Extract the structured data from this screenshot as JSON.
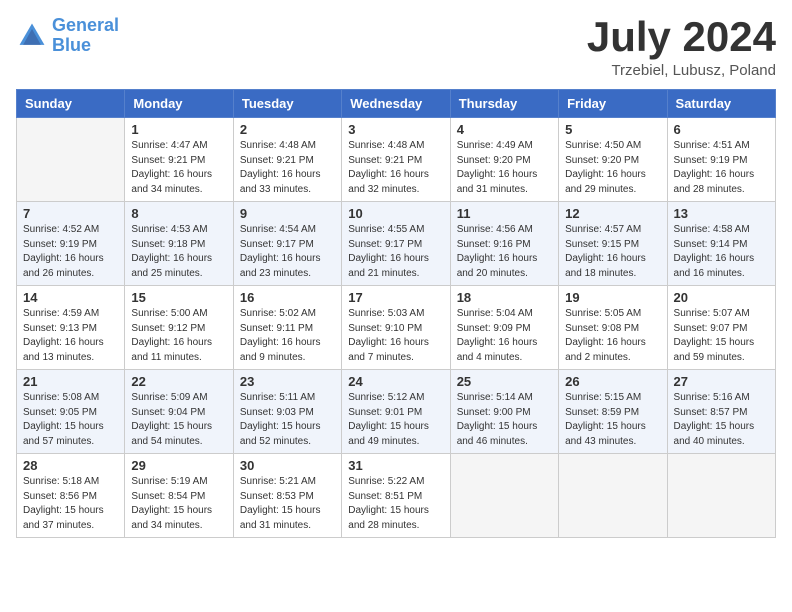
{
  "header": {
    "logo_line1": "General",
    "logo_line2": "Blue",
    "month_title": "July 2024",
    "subtitle": "Trzebiel, Lubusz, Poland"
  },
  "days_of_week": [
    "Sunday",
    "Monday",
    "Tuesday",
    "Wednesday",
    "Thursday",
    "Friday",
    "Saturday"
  ],
  "weeks": [
    [
      {
        "day": "",
        "sunrise": "",
        "sunset": "",
        "daylight": ""
      },
      {
        "day": "1",
        "sunrise": "Sunrise: 4:47 AM",
        "sunset": "Sunset: 9:21 PM",
        "daylight": "Daylight: 16 hours and 34 minutes."
      },
      {
        "day": "2",
        "sunrise": "Sunrise: 4:48 AM",
        "sunset": "Sunset: 9:21 PM",
        "daylight": "Daylight: 16 hours and 33 minutes."
      },
      {
        "day": "3",
        "sunrise": "Sunrise: 4:48 AM",
        "sunset": "Sunset: 9:21 PM",
        "daylight": "Daylight: 16 hours and 32 minutes."
      },
      {
        "day": "4",
        "sunrise": "Sunrise: 4:49 AM",
        "sunset": "Sunset: 9:20 PM",
        "daylight": "Daylight: 16 hours and 31 minutes."
      },
      {
        "day": "5",
        "sunrise": "Sunrise: 4:50 AM",
        "sunset": "Sunset: 9:20 PM",
        "daylight": "Daylight: 16 hours and 29 minutes."
      },
      {
        "day": "6",
        "sunrise": "Sunrise: 4:51 AM",
        "sunset": "Sunset: 9:19 PM",
        "daylight": "Daylight: 16 hours and 28 minutes."
      }
    ],
    [
      {
        "day": "7",
        "sunrise": "Sunrise: 4:52 AM",
        "sunset": "Sunset: 9:19 PM",
        "daylight": "Daylight: 16 hours and 26 minutes."
      },
      {
        "day": "8",
        "sunrise": "Sunrise: 4:53 AM",
        "sunset": "Sunset: 9:18 PM",
        "daylight": "Daylight: 16 hours and 25 minutes."
      },
      {
        "day": "9",
        "sunrise": "Sunrise: 4:54 AM",
        "sunset": "Sunset: 9:17 PM",
        "daylight": "Daylight: 16 hours and 23 minutes."
      },
      {
        "day": "10",
        "sunrise": "Sunrise: 4:55 AM",
        "sunset": "Sunset: 9:17 PM",
        "daylight": "Daylight: 16 hours and 21 minutes."
      },
      {
        "day": "11",
        "sunrise": "Sunrise: 4:56 AM",
        "sunset": "Sunset: 9:16 PM",
        "daylight": "Daylight: 16 hours and 20 minutes."
      },
      {
        "day": "12",
        "sunrise": "Sunrise: 4:57 AM",
        "sunset": "Sunset: 9:15 PM",
        "daylight": "Daylight: 16 hours and 18 minutes."
      },
      {
        "day": "13",
        "sunrise": "Sunrise: 4:58 AM",
        "sunset": "Sunset: 9:14 PM",
        "daylight": "Daylight: 16 hours and 16 minutes."
      }
    ],
    [
      {
        "day": "14",
        "sunrise": "Sunrise: 4:59 AM",
        "sunset": "Sunset: 9:13 PM",
        "daylight": "Daylight: 16 hours and 13 minutes."
      },
      {
        "day": "15",
        "sunrise": "Sunrise: 5:00 AM",
        "sunset": "Sunset: 9:12 PM",
        "daylight": "Daylight: 16 hours and 11 minutes."
      },
      {
        "day": "16",
        "sunrise": "Sunrise: 5:02 AM",
        "sunset": "Sunset: 9:11 PM",
        "daylight": "Daylight: 16 hours and 9 minutes."
      },
      {
        "day": "17",
        "sunrise": "Sunrise: 5:03 AM",
        "sunset": "Sunset: 9:10 PM",
        "daylight": "Daylight: 16 hours and 7 minutes."
      },
      {
        "day": "18",
        "sunrise": "Sunrise: 5:04 AM",
        "sunset": "Sunset: 9:09 PM",
        "daylight": "Daylight: 16 hours and 4 minutes."
      },
      {
        "day": "19",
        "sunrise": "Sunrise: 5:05 AM",
        "sunset": "Sunset: 9:08 PM",
        "daylight": "Daylight: 16 hours and 2 minutes."
      },
      {
        "day": "20",
        "sunrise": "Sunrise: 5:07 AM",
        "sunset": "Sunset: 9:07 PM",
        "daylight": "Daylight: 15 hours and 59 minutes."
      }
    ],
    [
      {
        "day": "21",
        "sunrise": "Sunrise: 5:08 AM",
        "sunset": "Sunset: 9:05 PM",
        "daylight": "Daylight: 15 hours and 57 minutes."
      },
      {
        "day": "22",
        "sunrise": "Sunrise: 5:09 AM",
        "sunset": "Sunset: 9:04 PM",
        "daylight": "Daylight: 15 hours and 54 minutes."
      },
      {
        "day": "23",
        "sunrise": "Sunrise: 5:11 AM",
        "sunset": "Sunset: 9:03 PM",
        "daylight": "Daylight: 15 hours and 52 minutes."
      },
      {
        "day": "24",
        "sunrise": "Sunrise: 5:12 AM",
        "sunset": "Sunset: 9:01 PM",
        "daylight": "Daylight: 15 hours and 49 minutes."
      },
      {
        "day": "25",
        "sunrise": "Sunrise: 5:14 AM",
        "sunset": "Sunset: 9:00 PM",
        "daylight": "Daylight: 15 hours and 46 minutes."
      },
      {
        "day": "26",
        "sunrise": "Sunrise: 5:15 AM",
        "sunset": "Sunset: 8:59 PM",
        "daylight": "Daylight: 15 hours and 43 minutes."
      },
      {
        "day": "27",
        "sunrise": "Sunrise: 5:16 AM",
        "sunset": "Sunset: 8:57 PM",
        "daylight": "Daylight: 15 hours and 40 minutes."
      }
    ],
    [
      {
        "day": "28",
        "sunrise": "Sunrise: 5:18 AM",
        "sunset": "Sunset: 8:56 PM",
        "daylight": "Daylight: 15 hours and 37 minutes."
      },
      {
        "day": "29",
        "sunrise": "Sunrise: 5:19 AM",
        "sunset": "Sunset: 8:54 PM",
        "daylight": "Daylight: 15 hours and 34 minutes."
      },
      {
        "day": "30",
        "sunrise": "Sunrise: 5:21 AM",
        "sunset": "Sunset: 8:53 PM",
        "daylight": "Daylight: 15 hours and 31 minutes."
      },
      {
        "day": "31",
        "sunrise": "Sunrise: 5:22 AM",
        "sunset": "Sunset: 8:51 PM",
        "daylight": "Daylight: 15 hours and 28 minutes."
      },
      {
        "day": "",
        "sunrise": "",
        "sunset": "",
        "daylight": ""
      },
      {
        "day": "",
        "sunrise": "",
        "sunset": "",
        "daylight": ""
      },
      {
        "day": "",
        "sunrise": "",
        "sunset": "",
        "daylight": ""
      }
    ]
  ]
}
